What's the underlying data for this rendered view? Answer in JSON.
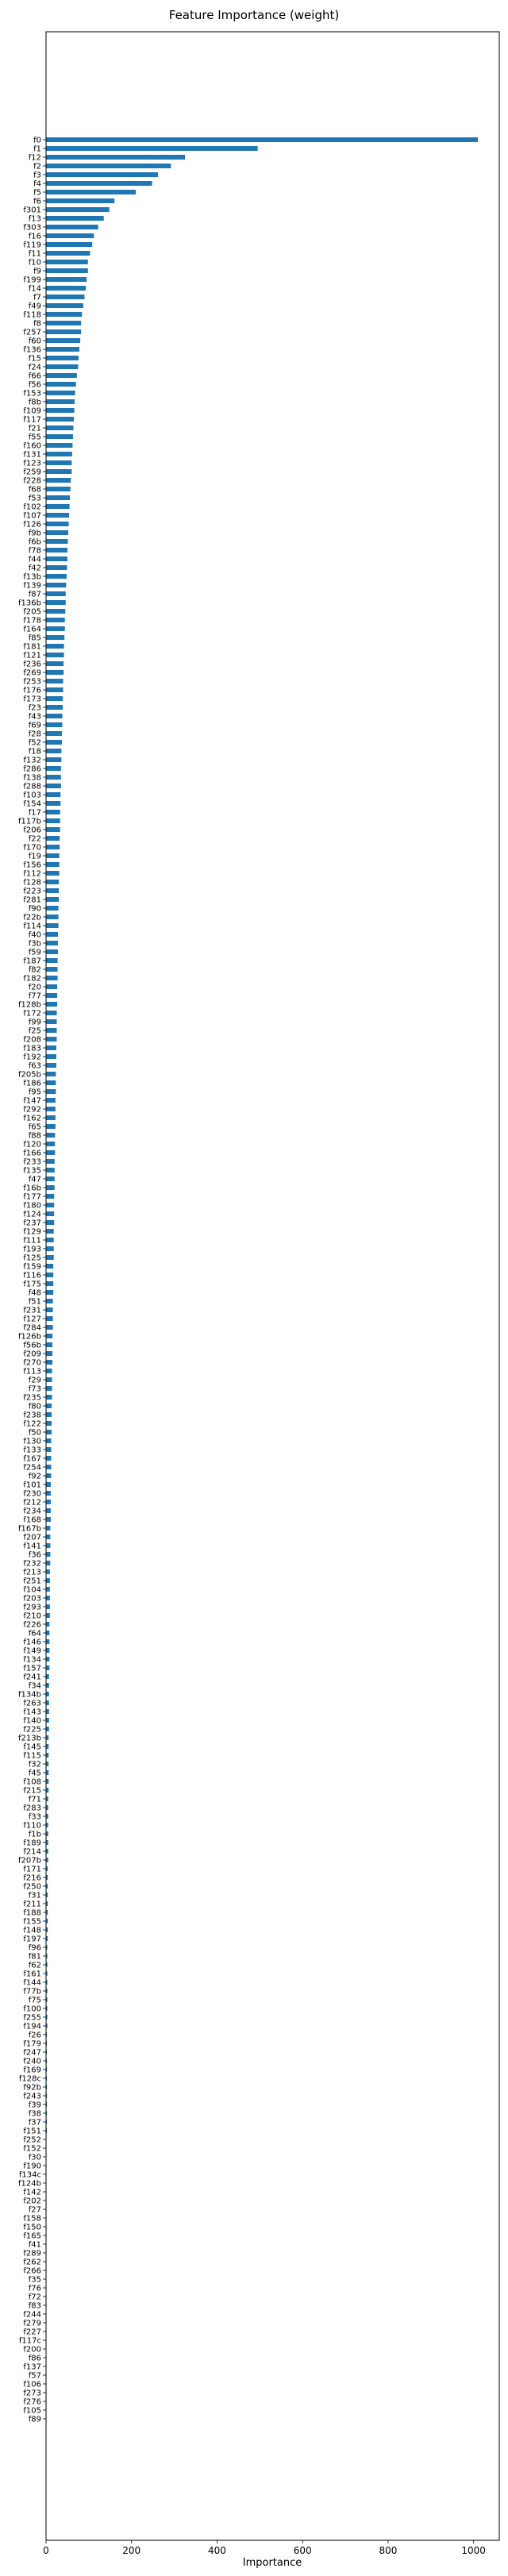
{
  "chart_data": {
    "type": "bar",
    "orientation": "horizontal",
    "title": "Feature Importance (weight)",
    "xlabel": "Importance",
    "ylabel": "",
    "xlim": [
      0,
      1060
    ],
    "xticks": [
      0,
      200,
      400,
      600,
      800,
      1000
    ],
    "grid": false,
    "legend": "none",
    "bar_color": "#1f77b4",
    "categories": [
      "f0",
      "f1",
      "f12",
      "f2",
      "f3",
      "f4",
      "f5",
      "f6",
      "f301",
      "f13",
      "f303",
      "f16",
      "f119",
      "f11",
      "f10",
      "f9",
      "f199",
      "f14",
      "f7",
      "f49",
      "f118",
      "f8",
      "f257",
      "f60",
      "f136",
      "f15",
      "f24",
      "f66",
      "f56",
      "f153",
      "f8b",
      "f109",
      "f117",
      "f21",
      "f55",
      "f160",
      "f131",
      "f123",
      "f259",
      "f228",
      "f68",
      "f53",
      "f102",
      "f107",
      "f126",
      "f9b",
      "f6b",
      "f78",
      "f44",
      "f42",
      "f13b",
      "f139",
      "f87",
      "f136b",
      "f205",
      "f178",
      "f164",
      "f85",
      "f181",
      "f121",
      "f236",
      "f269",
      "f253",
      "f176",
      "f173",
      "f23",
      "f43",
      "f69",
      "f28",
      "f52",
      "f18",
      "f132",
      "f286",
      "f138",
      "f288",
      "f103",
      "f154",
      "f17",
      "f117b",
      "f206",
      "f22",
      "f170",
      "f19",
      "f156",
      "f112",
      "f128",
      "f223",
      "f281",
      "f90",
      "f22b",
      "f114",
      "f40",
      "f3b",
      "f59",
      "f187",
      "f82",
      "f182",
      "f20",
      "f77",
      "f128b",
      "f172",
      "f99",
      "f25",
      "f208",
      "f183",
      "f192",
      "f63",
      "f205b",
      "f186",
      "f95",
      "f147",
      "f292",
      "f162",
      "f65",
      "f88",
      "f120",
      "f166",
      "f233",
      "f135",
      "f47",
      "f16b",
      "f177",
      "f180",
      "f124",
      "f237",
      "f129",
      "f111",
      "f193",
      "f125",
      "f159",
      "f116",
      "f175",
      "f48",
      "f51",
      "f231",
      "f127",
      "f284",
      "f126b",
      "f56b",
      "f209",
      "f270",
      "f113",
      "f29",
      "f73",
      "f235",
      "f80",
      "f238",
      "f122",
      "f50",
      "f130",
      "f133",
      "f167",
      "f254",
      "f92",
      "f101",
      "f230",
      "f212",
      "f234",
      "f168",
      "f167b",
      "f207",
      "f141",
      "f36",
      "f232",
      "f213",
      "f251",
      "f104",
      "f203",
      "f293",
      "f210",
      "f226",
      "f64",
      "f146",
      "f149",
      "f134",
      "f157",
      "f241",
      "f34",
      "f134b",
      "f263",
      "f143",
      "f140",
      "f225",
      "f213b",
      "f145",
      "f115",
      "f32",
      "f45",
      "f108",
      "f215",
      "f71",
      "f283",
      "f33",
      "f110",
      "f1b",
      "f189",
      "f214",
      "f207b",
      "f171",
      "f216",
      "f250",
      "f31",
      "f211",
      "f188",
      "f155",
      "f148",
      "f197",
      "f96",
      "f81",
      "f62",
      "f161",
      "f144",
      "f77b",
      "f75",
      "f100",
      "f255",
      "f194",
      "f26",
      "f179",
      "f247",
      "f240",
      "f169",
      "f128c",
      "f92b",
      "f243",
      "f39",
      "f38",
      "f37",
      "f151",
      "f252",
      "f152",
      "f30",
      "f190",
      "f134c",
      "f124b",
      "f142",
      "f202",
      "f27",
      "f158",
      "f150",
      "f165",
      "f41",
      "f289",
      "f262",
      "f266",
      "f35",
      "f76",
      "f72",
      "f83",
      "f244",
      "f279",
      "f227",
      "f117c",
      "f200",
      "f86",
      "f137",
      "f57",
      "f106",
      "f273",
      "f276",
      "f105",
      "f89"
    ],
    "values": [
      1010,
      495,
      325,
      292,
      262,
      248,
      210,
      160,
      148,
      135,
      122,
      112,
      108,
      103,
      98,
      98,
      95,
      93,
      90,
      87,
      84,
      82,
      82,
      80,
      78,
      76,
      75,
      72,
      70,
      68,
      67,
      66,
      65,
      64,
      63,
      62,
      61,
      60,
      60,
      58,
      57,
      56,
      55,
      54,
      53,
      52,
      51,
      50,
      50,
      49,
      48,
      47,
      46,
      46,
      45,
      44,
      44,
      43,
      42,
      42,
      41,
      41,
      40,
      40,
      39,
      39,
      38,
      38,
      37,
      37,
      36,
      36,
      35,
      35,
      35,
      34,
      34,
      33,
      33,
      33,
      32,
      32,
      31,
      31,
      31,
      30,
      30,
      30,
      29,
      29,
      29,
      28,
      28,
      28,
      27,
      27,
      27,
      26,
      26,
      26,
      25,
      25,
      25,
      25,
      24,
      24,
      24,
      23,
      23,
      23,
      22,
      22,
      22,
      22,
      21,
      21,
      21,
      20,
      20,
      20,
      20,
      19,
      19,
      19,
      19,
      18,
      18,
      18,
      18,
      17,
      17,
      17,
      17,
      16,
      16,
      16,
      16,
      15,
      15,
      15,
      15,
      14,
      14,
      14,
      14,
      13,
      13,
      13,
      13,
      12,
      12,
      12,
      12,
      12,
      11,
      11,
      11,
      11,
      11,
      10,
      10,
      10,
      10,
      10,
      9,
      9,
      9,
      9,
      9,
      9,
      8,
      8,
      8,
      8,
      8,
      8,
      7,
      7,
      7,
      7,
      7,
      7,
      7,
      6,
      6,
      6,
      6,
      6,
      6,
      6,
      5,
      5,
      5,
      5,
      5,
      5,
      5,
      5,
      4,
      4,
      4,
      4,
      4,
      4,
      4,
      4,
      4,
      3,
      3,
      3,
      3,
      3,
      3,
      3,
      3,
      3,
      3,
      2,
      2,
      2,
      2,
      2,
      2,
      2,
      2,
      2,
      2,
      2,
      2,
      1,
      1,
      1,
      1,
      1,
      1,
      1,
      1,
      1,
      1,
      1,
      1,
      1,
      1,
      1,
      1,
      1,
      1,
      1,
      1,
      1,
      1,
      1,
      1,
      1,
      1,
      1,
      1,
      1,
      1,
      1,
      1,
      1,
      1,
      1,
      1,
      1,
      1,
      1,
      1,
      1,
      1,
      1,
      1,
      1,
      1,
      1,
      1,
      1,
      1,
      1,
      1,
      1,
      1,
      1,
      1,
      1,
      1,
      1,
      1,
      1,
      1,
      1,
      1,
      1,
      1,
      1,
      1,
      1,
      1,
      1,
      1,
      1,
      1,
      1,
      1,
      1,
      1,
      1
    ]
  }
}
